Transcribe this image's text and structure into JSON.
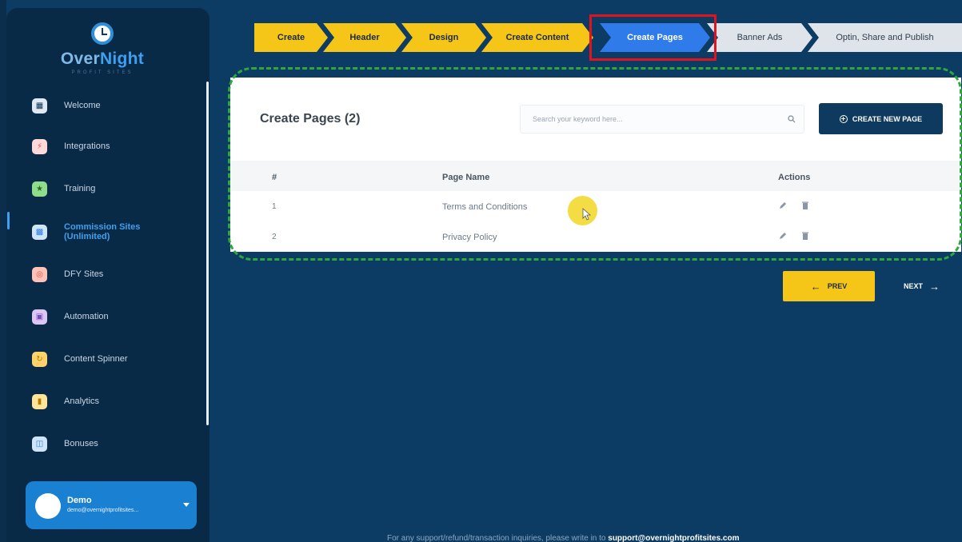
{
  "sidebar": {
    "logo": {
      "over": "Over",
      "night": "Night",
      "sub": "PROFIT SITES"
    },
    "items": [
      {
        "label": "Welcome",
        "icon": "building-icon",
        "color": "#dfe9f5"
      },
      {
        "label": "Integrations",
        "icon": "plug-icon",
        "color": "#ffd9d9"
      },
      {
        "label": "Training",
        "icon": "trophy-icon",
        "color": "#8fdc8a"
      },
      {
        "label": "Commission Sites\n(Unlimited)",
        "line1": "Commission Sites",
        "line2": "(Unlimited)",
        "icon": "grid-icon",
        "color": "#cfe5f7"
      },
      {
        "label": "DFY Sites",
        "icon": "target-icon",
        "color": "#ffc2b7"
      },
      {
        "label": "Automation",
        "icon": "robot-icon",
        "color": "#dcc7f4"
      },
      {
        "label": "Content Spinner",
        "icon": "spinner-icon",
        "color": "#ffd36a"
      },
      {
        "label": "Analytics",
        "icon": "chart-icon",
        "color": "#ffe49a"
      },
      {
        "label": "Bonuses",
        "icon": "gift-icon",
        "color": "#cfe5f7"
      }
    ],
    "user": {
      "name": "Demo",
      "email": "demo@overnightprofitsites..."
    }
  },
  "stepper": {
    "steps": [
      {
        "label": "Create",
        "state": "done"
      },
      {
        "label": "Header",
        "state": "done"
      },
      {
        "label": "Design",
        "state": "done"
      },
      {
        "label": "Create Content",
        "state": "done"
      },
      {
        "label": "Create Pages",
        "state": "current"
      },
      {
        "label": "Banner Ads",
        "state": "todo"
      },
      {
        "label": "Optin, Share and Publish",
        "state": "todo"
      }
    ]
  },
  "main": {
    "title": "Create Pages (2)",
    "search_placeholder": "Search your keyword here...",
    "create_button": "CREATE NEW PAGE",
    "table": {
      "headers": {
        "num": "#",
        "name": "Page Name",
        "actions": "Actions"
      },
      "rows": [
        {
          "num": "1",
          "name": "Terms and Conditions"
        },
        {
          "num": "2",
          "name": "Privacy Policy"
        }
      ]
    },
    "prev_label": "PREV",
    "next_label": "NEXT"
  },
  "footer": {
    "text": "For any support/refund/transaction inquiries, please write in to ",
    "email": "support@overnightprofitsites.com"
  },
  "colors": {
    "background": "#0c3c63",
    "sidebar": "#092a47",
    "step_done": "#f5c518",
    "step_current": "#2f7bea",
    "step_todo": "#dfe4ea",
    "accent": "#3ea0f0",
    "highlight_red": "#e0141e",
    "dashed_green": "#2ea83a"
  }
}
